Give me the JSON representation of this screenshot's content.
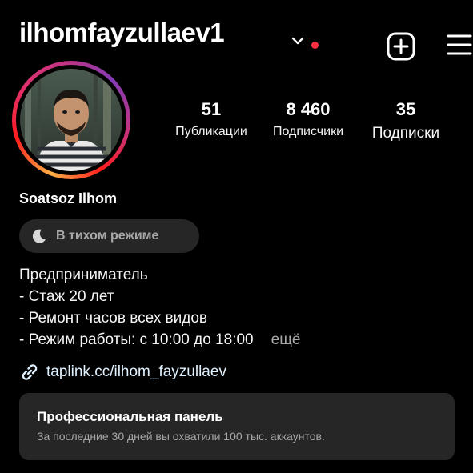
{
  "header": {
    "username": "ilhomfayzullaev1",
    "chevron_icon": "chevron-down-icon",
    "notification_color": "#ff3040",
    "add_icon": "plus-square-icon",
    "menu_icon": "hamburger-menu-icon"
  },
  "stats": [
    {
      "value": "51",
      "label": "Публикации"
    },
    {
      "value": "8 460",
      "label": "Подписчики"
    },
    {
      "value": "35",
      "label": "Подписки"
    }
  ],
  "profile": {
    "display_name": "Soatsoz Ilhom",
    "quiet_mode_label": "В тихом режиме",
    "quiet_mode_icon": "moon-icon"
  },
  "bio": {
    "lines": [
      "Предприниматель",
      "- Стаж 20 лет",
      "- Ремонт часов всех видов",
      "- Режим работы: с 10:00 до 18:00"
    ],
    "more_label": "ещё"
  },
  "link": {
    "icon": "link-icon",
    "text": "taplink.cc/ilhom_fayzullaev"
  },
  "dashboard": {
    "title": "Профессиональная панель",
    "subtitle": "За последние 30 дней вы охватили 100 тыс. аккаунтов."
  },
  "colors": {
    "background": "#000000",
    "card": "#262626",
    "muted_text": "#a8a8a8",
    "story_ring": [
      "#fcaf45",
      "#fd1d1d",
      "#e1306c",
      "#c13584",
      "#833ab4"
    ]
  }
}
